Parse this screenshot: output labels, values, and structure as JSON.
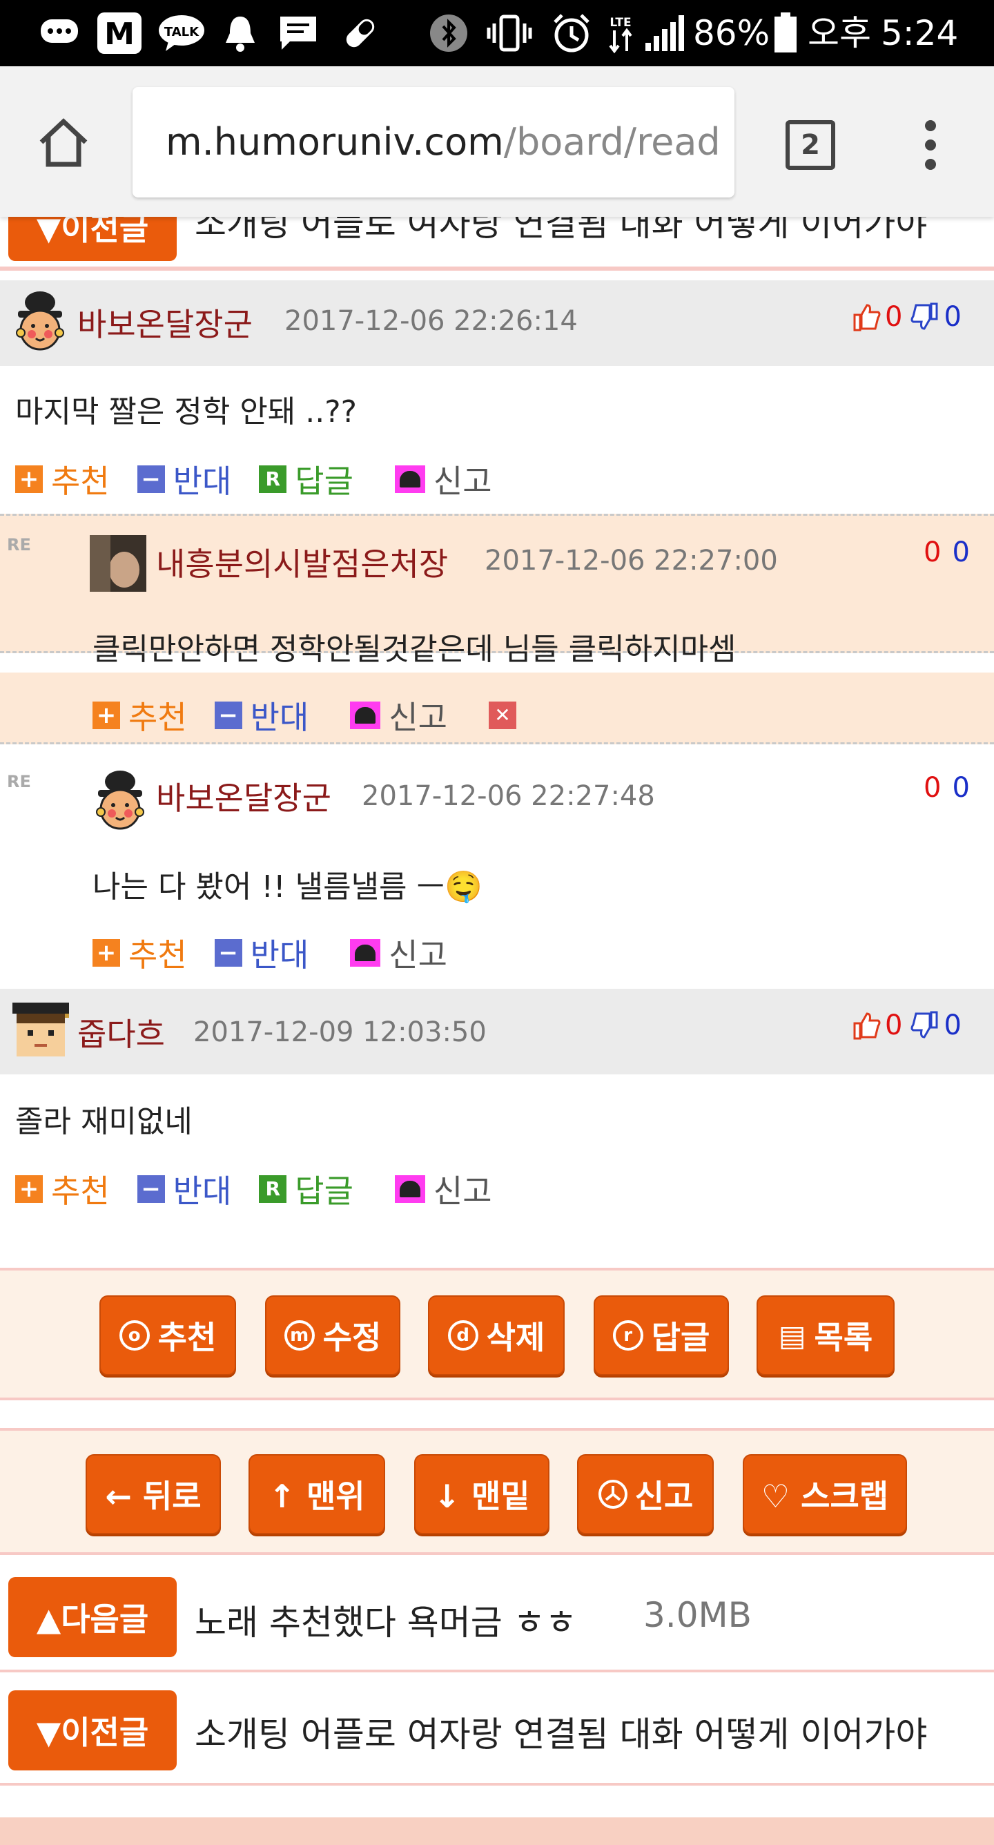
{
  "status_bar": {
    "battery": "86%",
    "ampm": "오후",
    "time": "5:24",
    "icons": [
      "message-icon",
      "m-app-icon",
      "kakaotalk-icon",
      "bell-icon",
      "chat-icon",
      "pill-icon",
      "bluetooth-icon",
      "vibrate-icon",
      "alarm-icon",
      "lte-icon",
      "signal-icon",
      "battery-icon"
    ],
    "talk_label": "TALK",
    "lte_label": "LTE"
  },
  "browser": {
    "url_host": "m.humoruniv.com",
    "url_path": "/board/read",
    "tab_count": "2"
  },
  "top_strip": {
    "prev_label": "▼이전글",
    "prev_title": "소개팅 어플로 여자랑 연결됨 대화 어떻게 이어가야"
  },
  "actions": {
    "recommend": "추천",
    "oppose": "반대",
    "reply": "답글",
    "report": "신고",
    "reply_icon_letter": "R",
    "delete_icon": "✕"
  },
  "comments": [
    {
      "nick": "바보온달장군",
      "date": "2017-12-06 22:26:14",
      "up": "0",
      "down": "0",
      "text": "마지막 짤은 정학 안돼 ..??"
    },
    {
      "nick": "줍다흐",
      "date": "2017-12-09 12:03:50",
      "up": "0",
      "down": "0",
      "text": "졸라 재미없네"
    }
  ],
  "replies": [
    {
      "re": "RE",
      "nick": "내흥분의시발점은처장",
      "date": "2017-12-06 22:27:00",
      "up": "0",
      "down": "0",
      "text": "클릭만안하면 정학안될것같은데 님들 클릭하지마셈"
    },
    {
      "re": "RE",
      "nick": "바보온달장군",
      "date": "2017-12-06 22:27:48",
      "up": "0",
      "down": "0",
      "text": "나는 다 봤어 !! 낼름낼름 ㅡ🤤"
    }
  ],
  "post_buttons": [
    {
      "icon": "o",
      "label": "추천"
    },
    {
      "icon": "m",
      "label": "수정"
    },
    {
      "icon": "d",
      "label": "삭제"
    },
    {
      "icon": "r",
      "label": "답글"
    },
    {
      "icon": "▤",
      "label": "목록"
    }
  ],
  "nav_buttons": [
    {
      "label": "← 뒤로"
    },
    {
      "label": "↑ 맨위"
    },
    {
      "label": "↓ 맨밑"
    },
    {
      "label": "신고"
    },
    {
      "label": "♡ 스크랩"
    }
  ],
  "next_prev": {
    "next_label": "▲다음글",
    "next_title": "노래 추천했다 욕머금 ㅎㅎ",
    "next_size": "3.0MB",
    "prev_label": "▼이전글",
    "prev_title": "소개팅 어플로 여자랑 연결됨 대화 어떻게 이어가야"
  }
}
